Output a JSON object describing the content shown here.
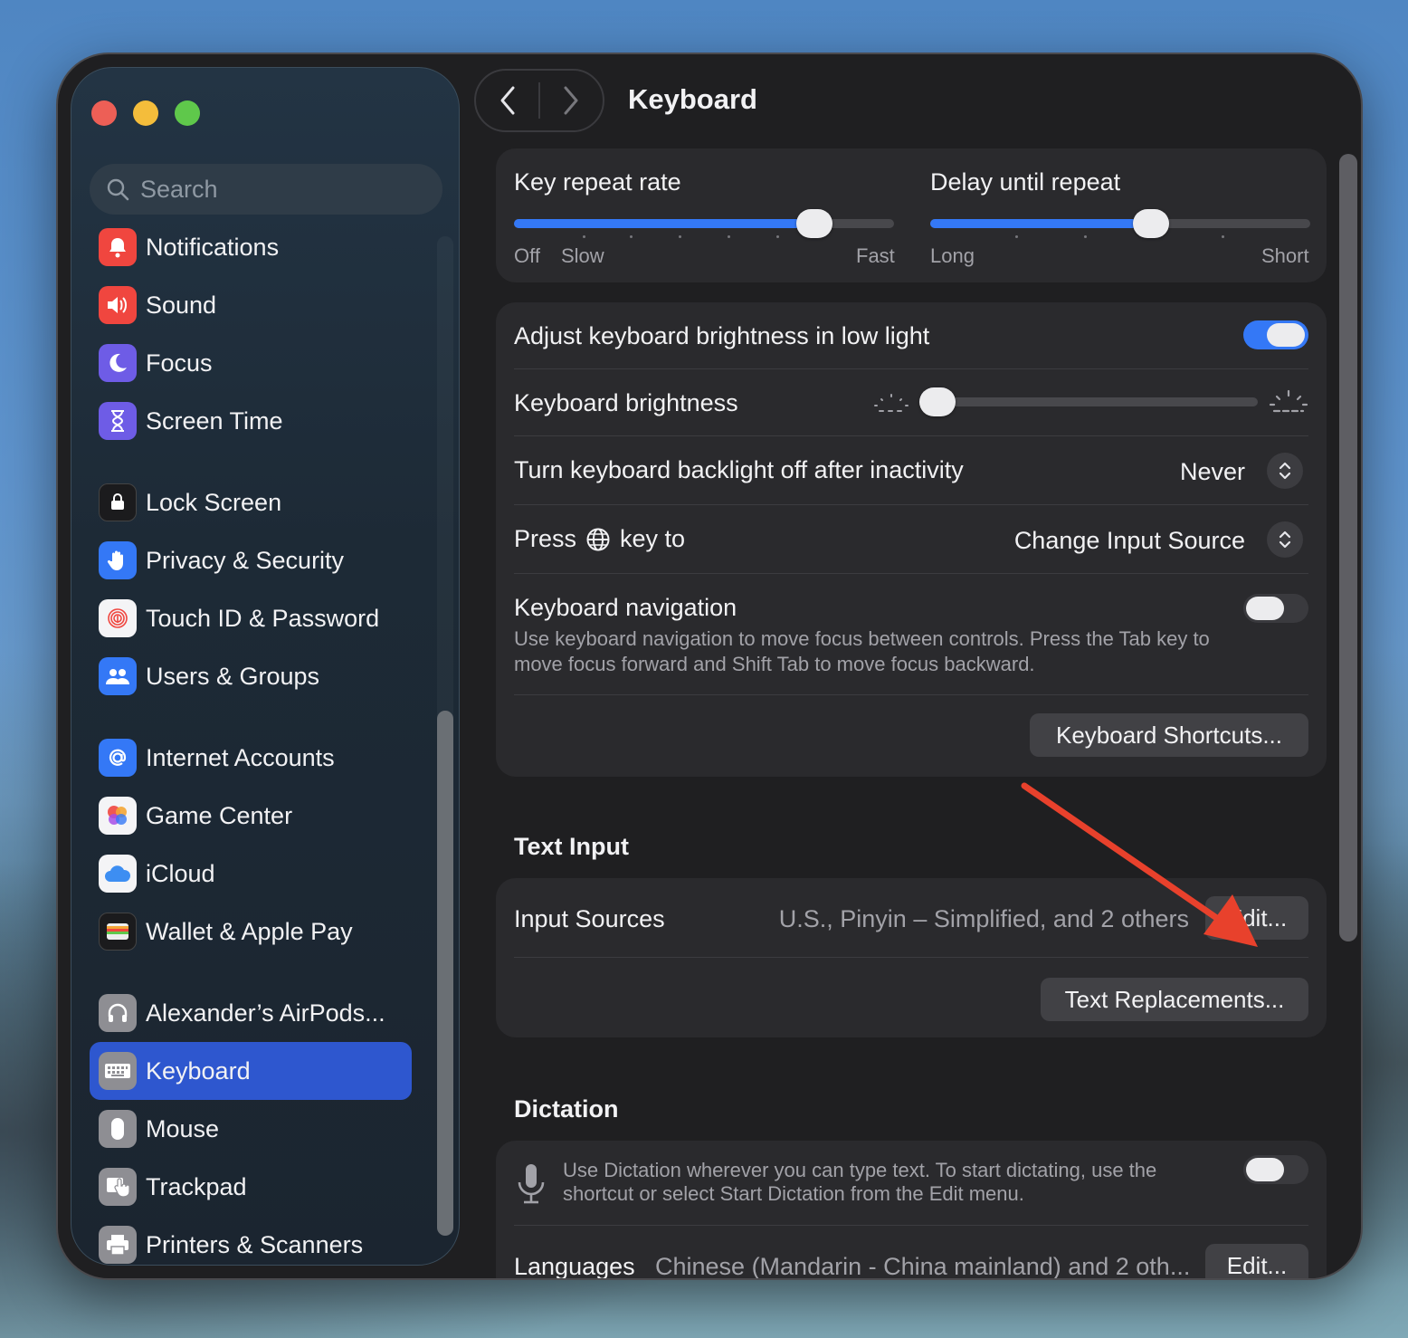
{
  "sidebar": {
    "search_placeholder": "Search",
    "items": [
      {
        "label": "Notifications",
        "icon": "bell-icon",
        "color": "#f0463f"
      },
      {
        "label": "Sound",
        "icon": "speaker-icon",
        "color": "#f0463f"
      },
      {
        "label": "Focus",
        "icon": "moon-icon",
        "color": "#6e5ce6"
      },
      {
        "label": "Screen Time",
        "icon": "hourglass-icon",
        "color": "#6e5ce6"
      },
      {
        "label": "Lock Screen",
        "icon": "lock-icon",
        "color": "#1b1b1d"
      },
      {
        "label": "Privacy & Security",
        "icon": "hand-icon",
        "color": "#3478f6"
      },
      {
        "label": "Touch ID & Password",
        "icon": "fingerprint-icon",
        "color": "#f4f4f6"
      },
      {
        "label": "Users & Groups",
        "icon": "users-icon",
        "color": "#3478f6"
      },
      {
        "label": "Internet Accounts",
        "icon": "at-icon",
        "color": "#3478f6"
      },
      {
        "label": "Game Center",
        "icon": "game-center-icon",
        "color": "#f4f4f6"
      },
      {
        "label": "iCloud",
        "icon": "cloud-icon",
        "color": "#f4f4f6"
      },
      {
        "label": "Wallet & Apple Pay",
        "icon": "wallet-icon",
        "color": "#1b1b1d"
      },
      {
        "label": "Alexander’s AirPods...",
        "icon": "headphones-icon",
        "color": "#8e8e93"
      },
      {
        "label": "Keyboard",
        "icon": "keyboard-icon",
        "color": "#8e8e93"
      },
      {
        "label": "Mouse",
        "icon": "mouse-icon",
        "color": "#8e8e93"
      },
      {
        "label": "Trackpad",
        "icon": "trackpad-icon",
        "color": "#8e8e93"
      },
      {
        "label": "Printers & Scanners",
        "icon": "printer-icon",
        "color": "#8e8e93"
      }
    ],
    "active": "Keyboard"
  },
  "header": {
    "title": "Keyboard"
  },
  "repeat": {
    "rate_label": "Key repeat rate",
    "rate_off": "Off",
    "rate_slow": "Slow",
    "rate_fast": "Fast",
    "rate_value": 0.82,
    "delay_label": "Delay until repeat",
    "delay_long": "Long",
    "delay_short": "Short",
    "delay_value": 0.59
  },
  "settings": {
    "adjust_brightness_label": "Adjust keyboard brightness in low light",
    "adjust_brightness_on": true,
    "brightness_label": "Keyboard brightness",
    "brightness_value": 0.0,
    "backlight_label": "Turn keyboard backlight off after inactivity",
    "backlight_value": "Never",
    "press_key_label_pre": "Press",
    "press_key_label_post": "key to",
    "press_key_value": "Change Input Source",
    "nav_label": "Keyboard navigation",
    "nav_desc": "Use keyboard navigation to move focus between controls. Press the Tab key to move focus forward and Shift Tab to move focus backward.",
    "nav_on": false,
    "shortcuts_button": "Keyboard Shortcuts..."
  },
  "text_input": {
    "section_title": "Text Input",
    "input_sources_label": "Input Sources",
    "input_sources_value": "U.S., Pinyin – Simplified, and 2 others",
    "edit_button": "Edit...",
    "replacements_button": "Text Replacements..."
  },
  "dictation": {
    "section_title": "Dictation",
    "desc": "Use Dictation wherever you can type text. To start dictating, use the shortcut or select Start Dictation from the Edit menu.",
    "on": false,
    "languages_label": "Languages",
    "languages_value": "Chinese (Mandarin - China mainland) and 2 oth...",
    "edit_button": "Edit..."
  },
  "annotation": {
    "arrow_color": "#e8412c"
  }
}
